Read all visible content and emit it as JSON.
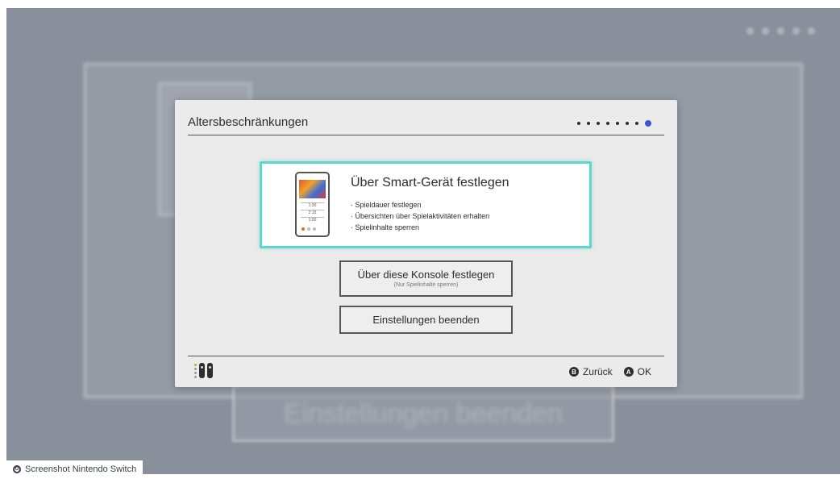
{
  "background": {
    "blurred_button_text": "Einstellungen beenden"
  },
  "dialog": {
    "title": "Altersbeschränkungen",
    "steps_total": 8,
    "current_step": 8,
    "accent_color": "#3a52d8",
    "smart_option": {
      "title": "Über Smart-Gerät festlegen",
      "bullets": [
        "Spieldauer festlegen",
        "Übersichten über Spielaktivitäten erhalten",
        "Spielinhalte sperren"
      ],
      "highlight_color": "#5ad8cb",
      "icon": "smartphone-app-icon",
      "phone_rows": [
        "1:30",
        "2:15",
        "1:00"
      ]
    },
    "console_option": {
      "label": "Über diese Konsole festlegen",
      "sublabel": "(Nur Spielinhalte sperren)"
    },
    "end_option": {
      "label": "Einstellungen beenden"
    }
  },
  "footer": {
    "controller_icon": "joycon-controller-icon",
    "back": {
      "button": "B",
      "label": "Zurück"
    },
    "ok": {
      "button": "A",
      "label": "OK"
    }
  },
  "credit": {
    "icon_letter": "G",
    "text": "Screenshot Nintendo Switch"
  }
}
